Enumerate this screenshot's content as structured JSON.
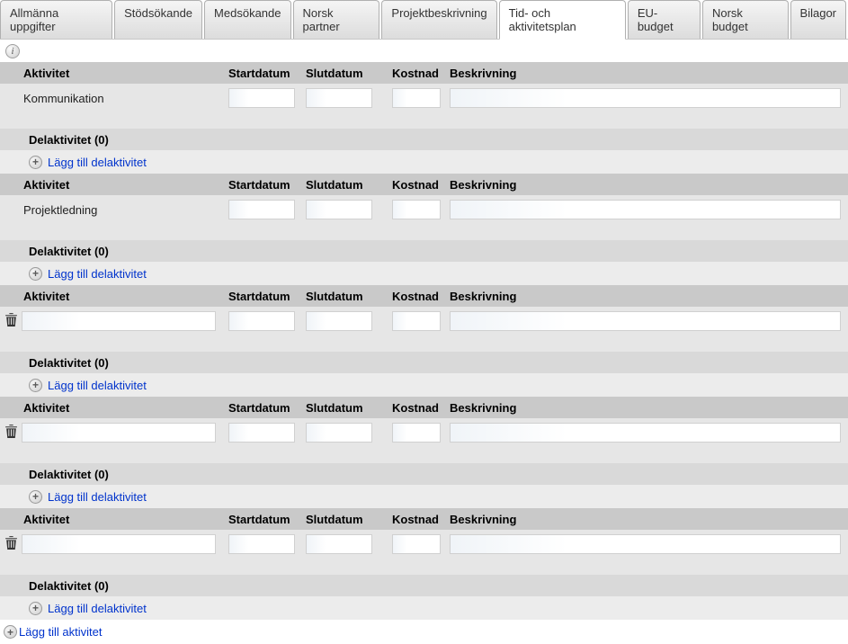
{
  "tabs": [
    {
      "label": "Allmänna uppgifter",
      "active": false
    },
    {
      "label": "Stödsökande",
      "active": false
    },
    {
      "label": "Medsökande",
      "active": false
    },
    {
      "label": "Norsk partner",
      "active": false
    },
    {
      "label": "Projektbeskrivning",
      "active": false
    },
    {
      "label": "Tid- och aktivitetsplan",
      "active": true
    },
    {
      "label": "EU-budget",
      "active": false
    },
    {
      "label": "Norsk budget",
      "active": false
    },
    {
      "label": "Bilagor",
      "active": false
    }
  ],
  "headers": {
    "activity": "Aktivitet",
    "start": "Startdatum",
    "end": "Slutdatum",
    "cost": "Kostnad",
    "desc": "Beskrivning"
  },
  "sub_label": "Delaktivitet (0)",
  "add_sub_label": "Lägg till delaktivitet",
  "add_activity_label": "Lägg till aktivitet",
  "activities": [
    {
      "name": "Kommunikation",
      "start": "",
      "end": "",
      "cost": "",
      "desc": "",
      "deletable": false,
      "editable_name": false
    },
    {
      "name": "Projektledning",
      "start": "",
      "end": "",
      "cost": "",
      "desc": "",
      "deletable": false,
      "editable_name": false
    },
    {
      "name": "",
      "start": "",
      "end": "",
      "cost": "",
      "desc": "",
      "deletable": true,
      "editable_name": true
    },
    {
      "name": "",
      "start": "",
      "end": "",
      "cost": "",
      "desc": "",
      "deletable": true,
      "editable_name": true
    },
    {
      "name": "",
      "start": "",
      "end": "",
      "cost": "",
      "desc": "",
      "deletable": true,
      "editable_name": true
    }
  ]
}
